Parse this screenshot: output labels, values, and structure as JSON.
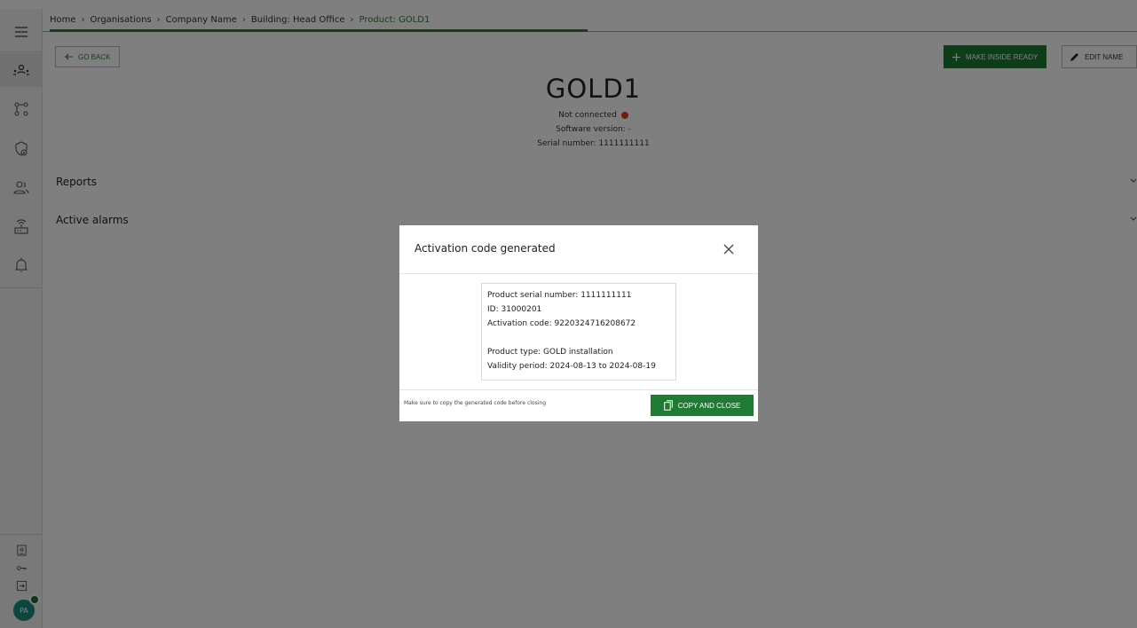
{
  "breadcrumb": [
    "Home",
    "Organisations",
    "Company Name",
    "Building: Head Office",
    "Product: GOLD1"
  ],
  "breadcrumb_separator": "›",
  "header": {
    "go_back_label": "GO BACK",
    "make_ready_label": "MAKE INSIDE READY",
    "edit_name_label": "EDIT NAME",
    "product_name": "GOLD1",
    "connection_status": "Not connected",
    "software_version": "Software version: -",
    "serial_number": "Serial number: 1111111111"
  },
  "sections": {
    "reports_label": "Reports",
    "alarms_label": "Active alarms"
  },
  "modal": {
    "title": "Activation code generated",
    "lines": {
      "serial": "Product serial number: 1111111111",
      "id": "ID: 31000201",
      "code": "Activation code: 9220324716208672",
      "type": "Product type: GOLD installation",
      "validity": "Validity period: 2024-08-13 to 2024-08-19"
    },
    "note": "Make sure to copy the generated code before closing",
    "copy_close_label": "COPY AND CLOSE"
  },
  "user": {
    "avatar_initials": "PA"
  },
  "colors": {
    "primary_green": "#1f7a34",
    "status_red": "#e53b1b",
    "avatar_teal": "#1c8a7c"
  },
  "icons": [
    "hamburger-menu-icon",
    "organisation-icon",
    "workflow-icon",
    "security-shield-icon",
    "users-icon",
    "router-icon",
    "bell-icon",
    "id-card-icon",
    "key-icon",
    "logout-icon",
    "arrow-left-icon",
    "plus-icon",
    "pencil-icon",
    "chevron-down-icon",
    "close-icon",
    "copy-icon"
  ]
}
